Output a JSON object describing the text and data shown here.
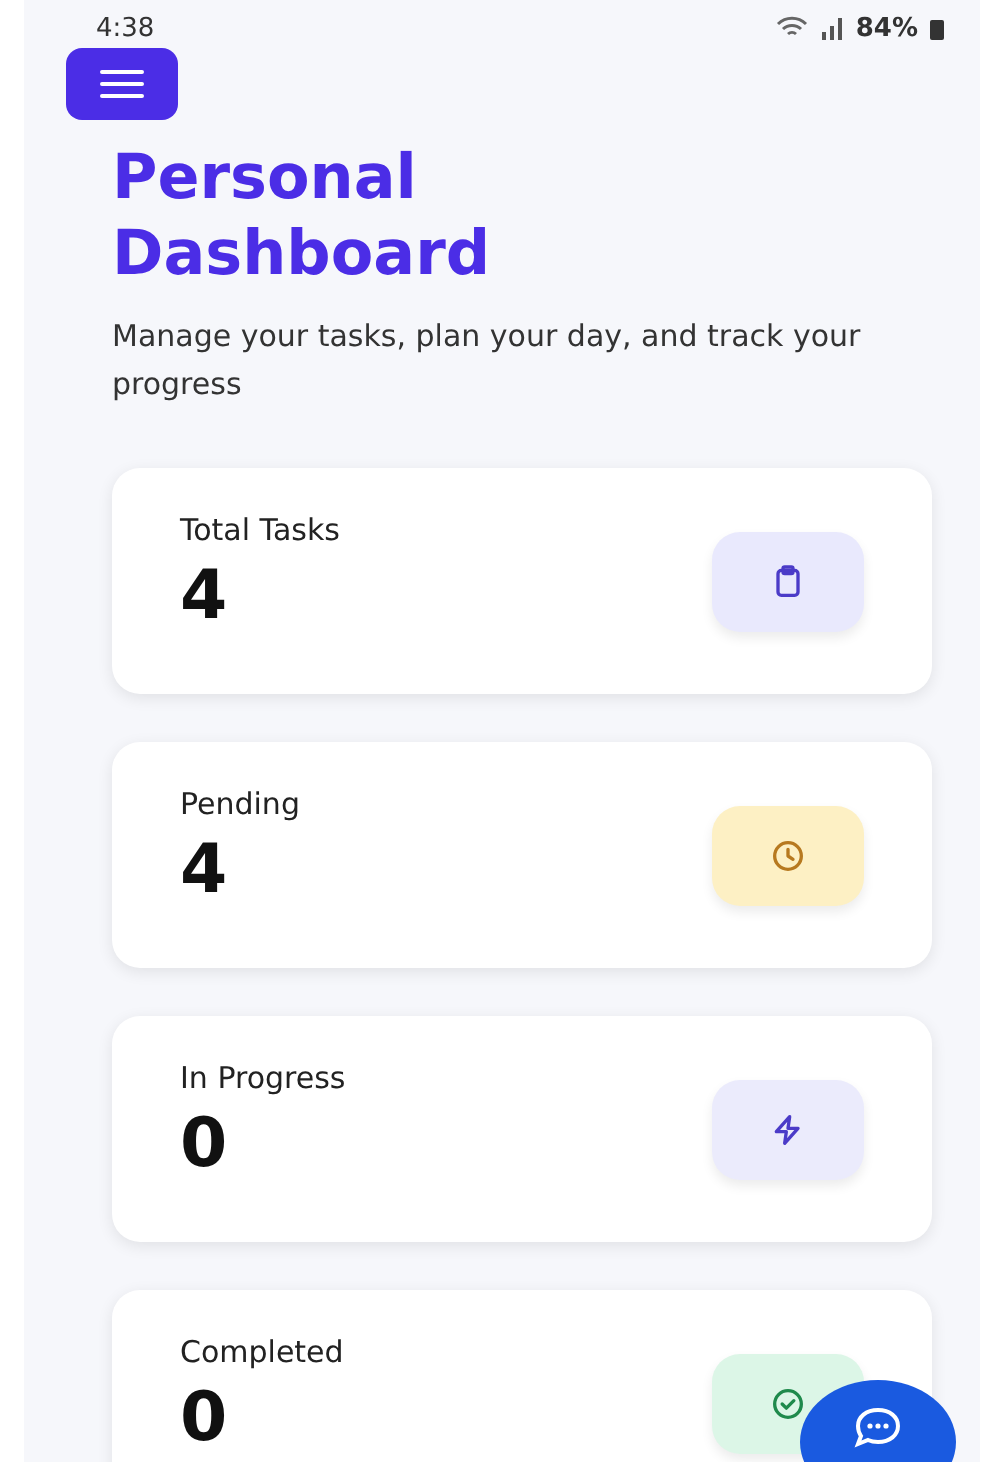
{
  "status_bar": {
    "time": "4:38",
    "battery": "84%"
  },
  "header": {
    "title": "Personal Dashboard",
    "subtitle": "Manage your tasks, plan your day, and track your progress"
  },
  "stats": [
    {
      "label": "Total Tasks",
      "value": "4",
      "kind": "total"
    },
    {
      "label": "Pending",
      "value": "4",
      "kind": "pending"
    },
    {
      "label": "In Progress",
      "value": "0",
      "kind": "progress"
    },
    {
      "label": "Completed",
      "value": "0",
      "kind": "completed"
    }
  ]
}
